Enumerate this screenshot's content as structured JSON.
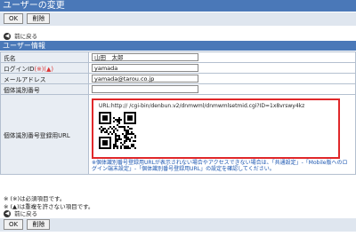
{
  "page": {
    "title": "ユーザーの変更"
  },
  "toolbar": {
    "ok_label": "OK",
    "delete_label": "削除"
  },
  "nav": {
    "back_label": "前に戻る"
  },
  "section": {
    "title": "ユーザー情報"
  },
  "form": {
    "name": {
      "label": "氏名",
      "value": "山田　太郎"
    },
    "login": {
      "label": "ログインID",
      "req_mark": "(※)(▲)",
      "value": "yamada"
    },
    "email": {
      "label": "メールアドレス",
      "value": "yamada@tarou.co.jp"
    },
    "device_id": {
      "label": "個体識別番号",
      "value": ""
    },
    "reg_url": {
      "label": "個体識別番号登録用URL",
      "url": "URL:http://              /cgi-bin/denbun.v2/dnmwml/dnmwmlsetmid.cgi?ID=1x8vrswy4kz",
      "note": "※個体識別番号登録用URLが表示されない場合やアクセスできない場合は、「共通設定」-「Mobile版へのログイン端末設定」-「個体識別番号登録用URL」の設定を確認してください。"
    }
  },
  "footnotes": {
    "required": "※ (※)は必須項目です。",
    "unique": "※ (▲)は重複を許さない項目です。"
  },
  "colors": {
    "header": "#4a78b8",
    "highlight": "#e0282a",
    "note": "#1a55b0"
  }
}
